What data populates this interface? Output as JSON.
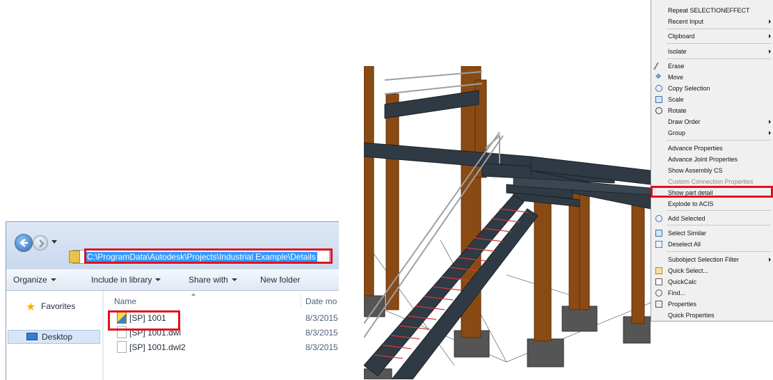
{
  "explorer": {
    "address_path": "C:\\ProgramData\\Autodesk\\Projects\\Industrial Example\\Details",
    "toolbar": {
      "organize": "Organize",
      "include_in_library": "Include in library",
      "share_with": "Share with",
      "new_folder": "New folder"
    },
    "nav": {
      "favorites": "Favorites",
      "desktop": "Desktop"
    },
    "columns": {
      "name": "Name",
      "date": "Date mo"
    },
    "files": [
      {
        "name": "[SP] 1001",
        "date": "8/3/2015",
        "icon": "special-folder-icon"
      },
      {
        "name": "[SP] 1001.dwl",
        "date": "8/3/2015",
        "icon": "file-icon"
      },
      {
        "name": "[SP] 1001.dwl2",
        "date": "8/3/2015",
        "icon": "file-icon"
      }
    ],
    "highlight_color": "#e0101e",
    "selection_color": "#3399ff"
  },
  "context_menu": {
    "items": {
      "repeat": "Repeat SELECTIONEFFECT",
      "recent_input": "Recent Input",
      "clipboard": "Clipboard",
      "isolate": "Isolate",
      "erase": "Erase",
      "move": "Move",
      "copy_selection": "Copy Selection",
      "scale": "Scale",
      "rotate": "Rotate",
      "draw_order": "Draw Order",
      "group": "Group",
      "advance_properties": "Advance Properties",
      "advance_joint_properties": "Advance Joint Properties",
      "show_assembly_cs": "Show Assembly CS",
      "custom_connection_properties": "Custom Connection Properties",
      "show_part_detail": "Show part detail",
      "explode_to_acis": "Explode to ACIS",
      "add_selected": "Add Selected",
      "select_similar": "Select Similar",
      "deselect_all": "Deselect All",
      "subobject_selection_filter": "Subobject Selection Filter",
      "quick_select": "Quick Select...",
      "quickcalc": "QuickCalc",
      "find": "Find...",
      "properties": "Properties",
      "quick_properties": "Quick Properties"
    }
  },
  "model": {
    "column_color": "#8a4a14",
    "beam_color": "#2f3a44",
    "footing_color": "#555555",
    "accent_color": "#d23a3a"
  }
}
